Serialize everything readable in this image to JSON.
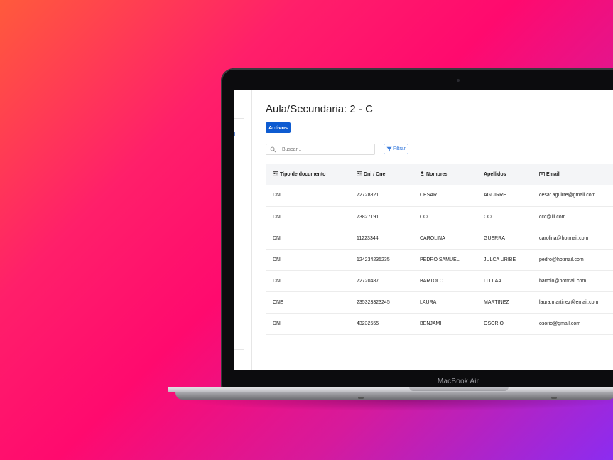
{
  "device": {
    "label": "MacBook Air"
  },
  "sidebar": {
    "fragments": [
      "r",
      "ol",
      "a"
    ]
  },
  "page": {
    "title": "Aula/Secundaria: 2 - C",
    "status_badge": "Activos"
  },
  "search": {
    "placeholder": "Buscar..."
  },
  "toolbar": {
    "filter_label": "Filtrar"
  },
  "table": {
    "columns": [
      {
        "label": "Tipo de documento",
        "icon": "id-card-icon"
      },
      {
        "label": "Dni / Cne",
        "icon": "id-card-icon"
      },
      {
        "label": "Nombres",
        "icon": "user-icon"
      },
      {
        "label": "Apellidos",
        "icon": ""
      },
      {
        "label": "Email",
        "icon": "envelope-icon"
      }
    ],
    "rows": [
      [
        "DNI",
        "72728821",
        "CESAR",
        "AGUIRRE",
        "cesar.aguirre@gmail.com"
      ],
      [
        "DNI",
        "73827191",
        "CCC",
        "CCC",
        "ccc@lll.com"
      ],
      [
        "DNI",
        "11223344",
        "CAROLINA",
        "GUERRA",
        "carolina@hotmail.com"
      ],
      [
        "DNI",
        "124234235235",
        "PEDRO SAMUEL",
        "JULCA URIBE",
        "pedro@hotmail.com"
      ],
      [
        "DNI",
        "72720487",
        "BARTOLO",
        "LLLLAA",
        "bartolo@hotmail.com"
      ],
      [
        "CNE",
        "235323323245",
        "LAURA",
        "MARTINEZ",
        "laura.martinez@email.com"
      ],
      [
        "DNI",
        "43232555",
        "BENJAMI",
        "OSORIO",
        "osorio@gmail.com"
      ]
    ]
  },
  "colors": {
    "accent": "#0d5bd1",
    "filter": "#3b7ddd"
  }
}
